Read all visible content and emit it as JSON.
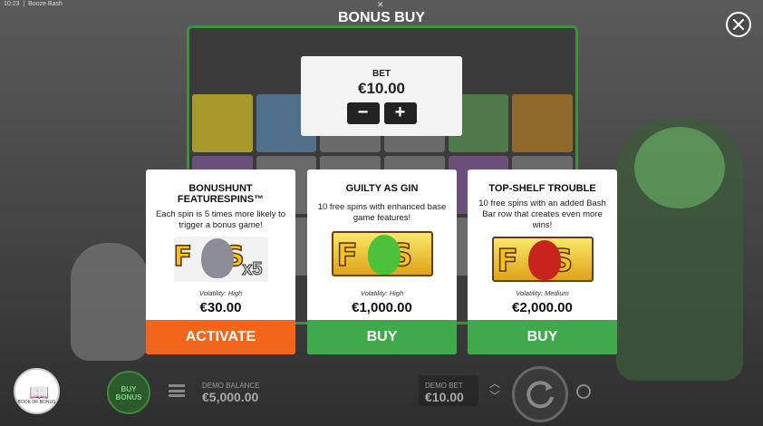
{
  "status": {
    "time": "10:23",
    "app_title": "Booze Bash"
  },
  "header": {
    "title": "BONUS BUY",
    "close_icon": "close-icon"
  },
  "bet": {
    "label": "BET",
    "value": "€10.00",
    "minus": "−",
    "plus": "+"
  },
  "cards": [
    {
      "title_line1": "BONUSHUNT",
      "title_line2": "FEATURESPINS™",
      "description": "Each spin is 5 times more likely to trigger a bonus game!",
      "art_letters": "FS",
      "art_multiplier": "x5",
      "volatility": "Volatility: High",
      "price": "€30.00",
      "action": "ACTIVATE",
      "action_color": "#f2661b"
    },
    {
      "title_line1": "GUILTY AS GIN",
      "title_line2": "",
      "description": "10 free spins with enhanced base game features!",
      "art_letters": "FS",
      "art_multiplier": "",
      "volatility": "Volatility: High",
      "price": "€1,000.00",
      "action": "BUY",
      "action_color": "#3fa94b"
    },
    {
      "title_line1": "TOP-SHELF TROUBLE",
      "title_line2": "",
      "description": "10 free spins with an added Bash Bar row that creates even more wins!",
      "art_letters": "FS",
      "art_multiplier": "",
      "volatility": "Volatility: Medium",
      "price": "€2,000.00",
      "action": "BUY",
      "action_color": "#3fa94b"
    }
  ],
  "footer": {
    "book_label": "BOOK OF BONUS",
    "buy_bonus": "BUY BONUS",
    "demo_balance_label": "DEMO BALANCE",
    "demo_balance_value": "€5,000.00",
    "demo_bet_label": "DEMO BET",
    "demo_bet_value": "€10.00"
  }
}
